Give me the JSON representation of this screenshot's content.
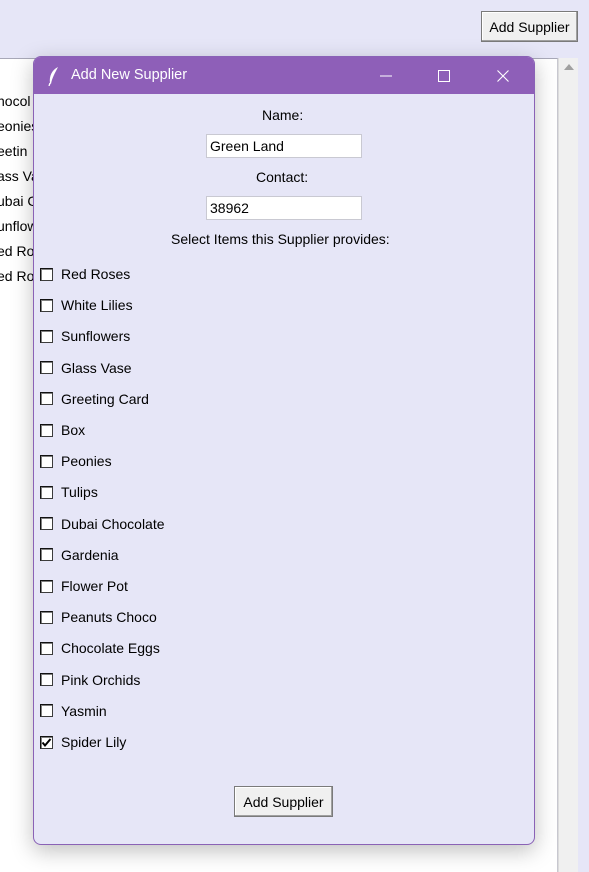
{
  "main": {
    "top_button_label": "Add Supplier",
    "list_fragments": [
      "hocol",
      "eonies",
      "eetin",
      "ass Va",
      "ubai C",
      "unflow",
      "ed Ros",
      "ed Ros"
    ]
  },
  "dialog": {
    "title": "Add New Supplier",
    "name_label": "Name:",
    "name_value": "Green Land",
    "contact_label": "Contact:",
    "contact_value": "38962",
    "items_label": "Select Items this Supplier provides:",
    "items": [
      {
        "label": "Red Roses",
        "checked": false
      },
      {
        "label": "White Lilies",
        "checked": false
      },
      {
        "label": "Sunflowers",
        "checked": false
      },
      {
        "label": "Glass Vase",
        "checked": false
      },
      {
        "label": "Greeting Card",
        "checked": false
      },
      {
        "label": "Box",
        "checked": false
      },
      {
        "label": "Peonies",
        "checked": false
      },
      {
        "label": "Tulips",
        "checked": false
      },
      {
        "label": "Dubai Chocolate",
        "checked": false
      },
      {
        "label": "Gardenia",
        "checked": false
      },
      {
        "label": "Flower Pot",
        "checked": false
      },
      {
        "label": "Peanuts Choco",
        "checked": false
      },
      {
        "label": "Chocolate Eggs",
        "checked": false
      },
      {
        "label": "Pink Orchids",
        "checked": false
      },
      {
        "label": "Yasmin",
        "checked": false
      },
      {
        "label": "Spider Lily",
        "checked": true
      }
    ],
    "submit_label": "Add Supplier"
  },
  "colors": {
    "titlebar": "#8e5fb8",
    "window_bg": "#e6e6f7"
  },
  "icons": {
    "title_icon": "feather-icon",
    "minimize": "minimize-icon",
    "maximize": "maximize-icon",
    "close": "close-icon"
  }
}
